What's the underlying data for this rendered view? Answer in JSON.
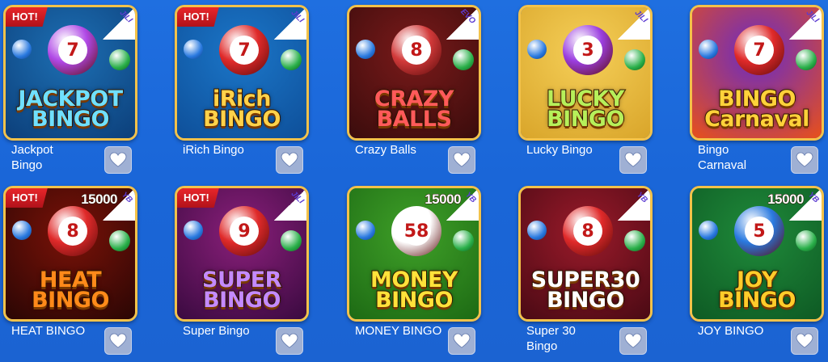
{
  "games": [
    {
      "title": "Jackpot\nBingo",
      "hot": "HOT!",
      "provider": "JILI",
      "logo": "JACKPOT\nBINGO",
      "bg": "#1d6fb3",
      "bg2": "#0c3f7a",
      "logo_color": "#6fe0ff",
      "ball_number": "7",
      "ball_color": "#b049e6"
    },
    {
      "title": "iRich Bingo",
      "hot": "HOT!",
      "provider": "JILI",
      "logo": "iRich\nBINGO",
      "bg": "#1b76c8",
      "bg2": "#0e4f99",
      "logo_color": "#ffd24a",
      "ball_number": "7",
      "ball_color": "#e02a2a"
    },
    {
      "title": "Crazy Balls",
      "hot": "",
      "provider": "EVO",
      "logo": "CRAZY\nBALLS",
      "bg": "#7a1a1a",
      "bg2": "#3a0c0c",
      "logo_color": "#ff5a5a",
      "ball_number": "8",
      "ball_color": "#d23a3a"
    },
    {
      "title": "Lucky Bingo",
      "hot": "",
      "provider": "JILI",
      "logo": "LUCKY\nBINGO",
      "bg": "#f5cf58",
      "bg2": "#d9a52a",
      "logo_color": "#b6f05a",
      "ball_number": "3",
      "ball_color": "#9b3fe0"
    },
    {
      "title": "Bingo\nCarnaval",
      "hot": "",
      "provider": "JILI",
      "logo": "BINGO\nCarnaval",
      "bg": "#6a2bc4",
      "bg2": "#e8501a",
      "logo_color": "#ffd23a",
      "ball_number": "7",
      "ball_color": "#e02a2a"
    },
    {
      "title": "HEAT BINGO",
      "hot": "HOT!",
      "provider": "YB",
      "jackpot": "15000",
      "logo": "HEAT\nBINGO",
      "bg": "#7a1208",
      "bg2": "#2a0604",
      "logo_color": "#ff8a1a",
      "ball_number": "8",
      "ball_color": "#e02a2a"
    },
    {
      "title": "Super Bingo",
      "hot": "HOT!",
      "provider": "JILI",
      "logo": "SUPER\nBINGO",
      "bg": "#8a1f7a",
      "bg2": "#3a0a40",
      "logo_color": "#c48aff",
      "ball_number": "9",
      "ball_color": "#e02a2a"
    },
    {
      "title": "MONEY BINGO",
      "hot": "",
      "provider": "YB",
      "jackpot": "15000",
      "logo": "MONEY\nBINGO",
      "bg": "#3fa028",
      "bg2": "#1d6a14",
      "logo_color": "#ffe23a",
      "ball_number": "58",
      "ball_color": "#ffffff"
    },
    {
      "title": "Super 30\nBingo",
      "hot": "",
      "provider": "YB",
      "logo": "SUPER30\nBINGO",
      "bg": "#9a1a2a",
      "bg2": "#4a0a14",
      "logo_color": "#ffffff",
      "ball_number": "8",
      "ball_color": "#e02a2a"
    },
    {
      "title": "JOY BINGO",
      "hot": "",
      "provider": "YB",
      "jackpot": "15000",
      "logo": "JOY\nBINGO",
      "bg": "#1f8a3a",
      "bg2": "#0e5a24",
      "logo_color": "#ffcc2a",
      "ball_number": "5",
      "ball_color": "#2a7ae0"
    }
  ],
  "icons": {
    "favorite": "heart-icon"
  },
  "colors": {
    "page_bg": "#1f6fe0",
    "border": "#f3c24a",
    "hot": "#e8262a",
    "fav_bg": "#9fb0d4"
  }
}
